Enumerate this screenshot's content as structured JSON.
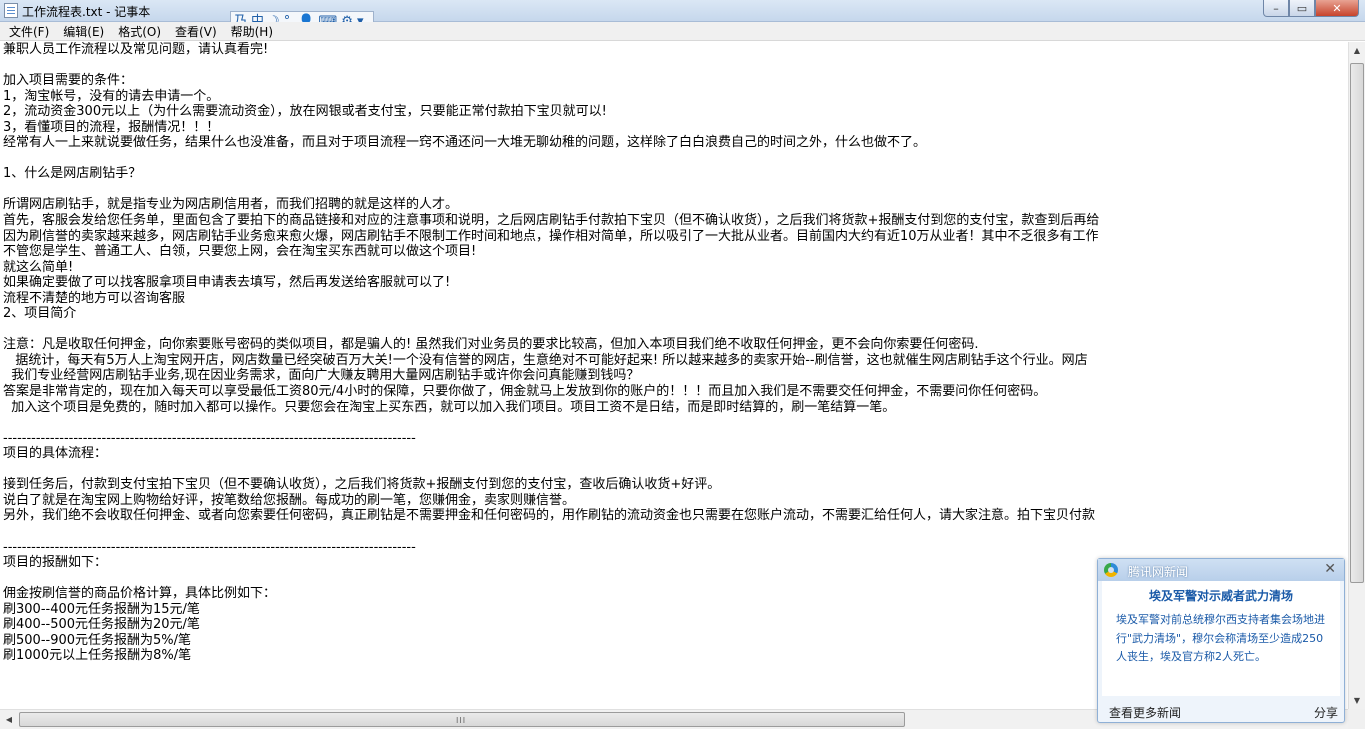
{
  "window": {
    "title": "工作流程表.txt - 记事本",
    "buttons": {
      "minimize": "–",
      "maximize": "▭",
      "close": "✕"
    }
  },
  "ime": {
    "glyph1": "乃",
    "mode": "中",
    "moon": "☽",
    "punct": "°,",
    "person": "👤",
    "keyboard": "⌨",
    "gear": "⚙",
    "more": "▾"
  },
  "menu": [
    "文件(F)",
    "编辑(E)",
    "格式(O)",
    "查看(V)",
    "帮助(H)"
  ],
  "document": {
    "lines": [
      "兼职人员工作流程以及常见问题，请认真看完!",
      "",
      "加入项目需要的条件：",
      "1，淘宝帐号，没有的请去申请一个。",
      "2，流动资金300元以上（为什么需要流动资金），放在网银或者支付宝，只要能正常付款拍下宝贝就可以!",
      "3，看懂项目的流程，报酬情况！！！",
      "经常有人一上来就说要做任务，结果什么也没准备，而且对于项目流程一窍不通还问一大堆无聊幼稚的问题，这样除了白白浪费自己的时间之外，什么也做不了。",
      "",
      "1、什么是网店刷钻手？",
      "",
      "所谓网店刷钻手，就是指专业为网店刷信用者，而我们招聘的就是这样的人才。",
      "首先，客服会发给您任务单，里面包含了要拍下的商品链接和对应的注意事项和说明，之后网店刷钻手付款拍下宝贝（但不确认收货），之后我们将货款+报酬支付到您的支付宝，款查到后再给",
      "因为刷信誉的卖家越来越多，网店刷钻手业务愈来愈火爆，网店刷钻手不限制工作时间和地点，操作相对简单，所以吸引了一大批从业者。目前国内大约有近10万从业者！其中不乏很多有工作",
      "不管您是学生、普通工人、白领，只要您上网，会在淘宝买东西就可以做这个项目!",
      "就这么简单!",
      "如果确定要做了可以找客服拿项目申请表去填写，然后再发送给客服就可以了!",
      "流程不清楚的地方可以咨询客服",
      "2、项目简介",
      "",
      "注意：凡是收取任何押金，向你索要账号密码的类似项目，都是骗人的! 虽然我们对业务员的要求比较高，但加入本项目我们绝不收取任何押金，更不会向你索要任何密码.",
      "   据统计，每天有5万人上淘宝网开店，网店数量已经突破百万大关!一个没有信誉的网店，生意绝对不可能好起来! 所以越来越多的卖家开始--刷信誉，这也就催生网店刷钻手这个行业。网店",
      "  我们专业经营网店刷钻手业务,现在因业务需求，面向广大赚友聘用大量网店刷钻手或许你会问真能赚到钱吗？",
      "答案是非常肯定的，现在加入每天可以享受最低工资80元/4小时的保障，只要你做了，佣金就马上发放到你的账户的！！！而且加入我们是不需要交任何押金，不需要问你任何密码。",
      "  加入这个项目是免费的，随时加入都可以操作。只要您会在淘宝上买东西，就可以加入我们项目。项目工资不是日结，而是即时结算的，刷一笔结算一笔。",
      "",
      "----------------------------------------------------------------------------------------",
      "项目的具体流程：",
      "",
      "接到任务后，付款到支付宝拍下宝贝（但不要确认收货），之后我们将货款+报酬支付到您的支付宝，查收后确认收货+好评。",
      "说白了就是在淘宝网上购物给好评，按笔数给您报酬。每成功的刷一笔，您赚佣金，卖家则赚信誉。",
      "另外，我们绝不会收取任何押金、或者向您索要任何密码，真正刷钻是不需要押金和任何密码的，用作刷钻的流动资金也只需要在您账户流动，不需要汇给任何人，请大家注意。拍下宝贝付款",
      "",
      "----------------------------------------------------------------------------------------",
      "项目的报酬如下：",
      "",
      "佣金按刷信誉的商品价格计算，具体比例如下：",
      "刷300--400元任务报酬为15元/笔",
      "刷400--500元任务报酬为20元/笔",
      "刷500--900元任务报酬为5%/笔",
      "刷1000元以上任务报酬为8%/笔"
    ]
  },
  "scrollbars": {
    "up": "▲",
    "down": "▼",
    "left": "◀",
    "right": "▶",
    "grip": "III"
  },
  "news_popup": {
    "source": "腾讯网新闻",
    "close": "✕",
    "headline": "埃及军警对示威者武力清场",
    "summary": "埃及军警对前总统穆尔西支持者集会场地进行\"武力清场\"，穆尔会称清场至少造成250人丧生，埃及官方称2人死亡。",
    "more_link": "查看更多新闻",
    "share": "分享"
  }
}
